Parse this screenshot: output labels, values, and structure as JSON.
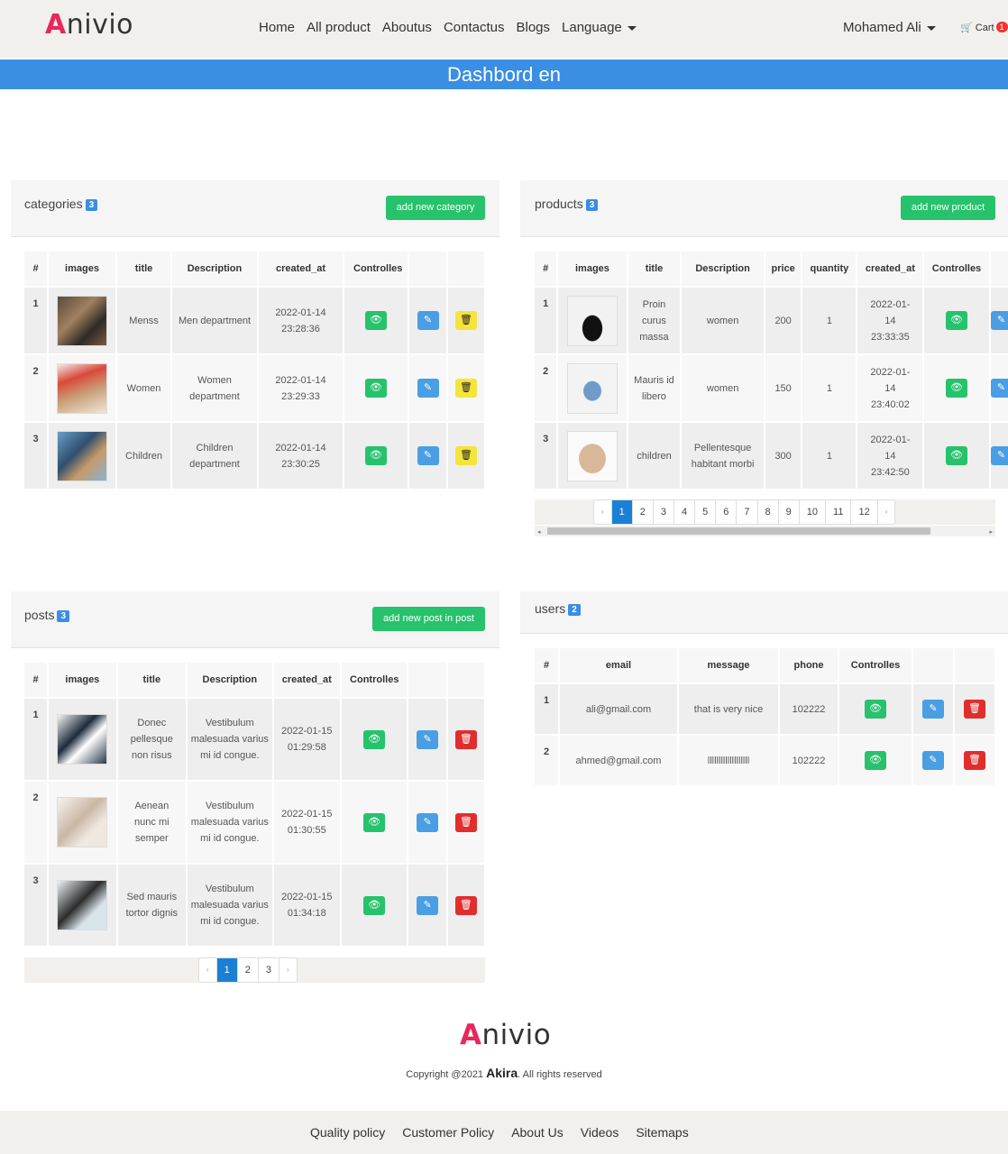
{
  "brand": {
    "logo_mark": "A",
    "logo_rest": "nivio",
    "accent": "#e8275b"
  },
  "nav": {
    "items": [
      "Home",
      "All product",
      "Aboutus",
      "Contactus",
      "Blogs",
      "Language"
    ],
    "user": "Mohamed Ali",
    "cart_label": "Cart",
    "cart_count": "1"
  },
  "banner": {
    "title": "Dashbord en",
    "color": "#3a8ee3"
  },
  "categories": {
    "title": "categories",
    "count": "3",
    "add_label": "add new category",
    "headers": [
      "#",
      "images",
      "title",
      "Description",
      "created_at",
      "Controlles"
    ],
    "rows": [
      {
        "num": "1",
        "title": "Menss",
        "description": "Men department",
        "created": "2022-01-14 23:28:36"
      },
      {
        "num": "2",
        "title": "Women",
        "description": "Women department",
        "created": "2022-01-14 23:29:33"
      },
      {
        "num": "3",
        "title": "Children",
        "description": "Children department",
        "created": "2022-01-14 23:30:25"
      }
    ]
  },
  "products": {
    "title": "products",
    "count": "3",
    "add_label": "add new product",
    "headers": [
      "#",
      "images",
      "title",
      "Description",
      "price",
      "quantity",
      "created_at",
      "Controlles"
    ],
    "rows": [
      {
        "num": "1",
        "title": "Proin curus massa",
        "description": "women",
        "price": "200",
        "quantity": "1",
        "created": "2022-01-14 23:33:35"
      },
      {
        "num": "2",
        "title": "Mauris id libero",
        "description": "women",
        "price": "150",
        "quantity": "1",
        "created": "2022-01-14 23:40:02"
      },
      {
        "num": "3",
        "title": "children",
        "description": "Pellentesque habitant morbi",
        "price": "300",
        "quantity": "1",
        "created": "2022-01-14 23:42:50"
      }
    ],
    "pages": [
      "‹",
      "1",
      "2",
      "3",
      "4",
      "5",
      "6",
      "7",
      "8",
      "9",
      "10",
      "11",
      "12",
      "›"
    ]
  },
  "posts": {
    "title": "posts",
    "count": "3",
    "add_label": "add new post in post",
    "headers": [
      "#",
      "images",
      "title",
      "Description",
      "created_at",
      "Controlles"
    ],
    "rows": [
      {
        "num": "1",
        "title": "Donec pellesque non risus",
        "description": "Vestibulum malesuada varius mi id congue.",
        "created": "2022-01-15 01:29:58"
      },
      {
        "num": "2",
        "title": "Aenean nunc mi semper",
        "description": "Vestibulum malesuada varius mi id congue.",
        "created": "2022-01-15 01:30:55"
      },
      {
        "num": "3",
        "title": "Sed mauris tortor dignis",
        "description": "Vestibulum malesuada varius mi id congue.",
        "created": "2022-01-15 01:34:18"
      }
    ],
    "pages": [
      "‹",
      "1",
      "2",
      "3",
      "›"
    ]
  },
  "users": {
    "title": "users",
    "count": "2",
    "headers": [
      "#",
      "email",
      "message",
      "phone",
      "Controlles"
    ],
    "rows": [
      {
        "num": "1",
        "email": "ali@gmail.com",
        "message": "that is very nice",
        "phone": "102222"
      },
      {
        "num": "2",
        "email": "ahmed@gmail.com",
        "message": "lllllllllllllllllll",
        "phone": "102222"
      }
    ]
  },
  "footer": {
    "copyright_prefix": "Copyright @2021",
    "copyright_brand": "Akira",
    "copyright_suffix": ". All rights reserved",
    "links": [
      "Quality policy",
      "Customer Policy",
      "About Us",
      "Videos",
      "Sitemaps"
    ]
  },
  "icons": {
    "view": "eye-icon",
    "edit": "pencil-icon",
    "delete": "trash-icon",
    "cart": "cart-icon"
  }
}
